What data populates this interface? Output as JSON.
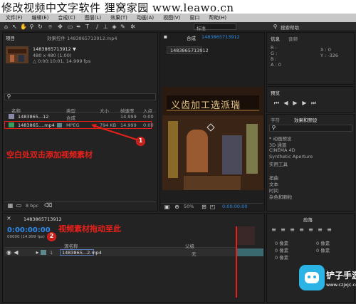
{
  "banner": {
    "title": "修改视频中文字软件 狸窝家园 www.leawo.cn"
  },
  "menu": [
    "文件(F)",
    "编辑(E)",
    "合成(C)",
    "图层(L)",
    "效果(T)",
    "动画(A)",
    "视图(V)",
    "窗口",
    "帮助(H)"
  ],
  "toolbar": {
    "mode_label": "标准",
    "search_placeholder": "搜索帮助"
  },
  "project_panel": {
    "tab_project": "项目",
    "tab_effects": "效果控件 1483865713912.mp4",
    "item_name": "1483865713912 ▼",
    "item_dims": "480 x 480 (1.00)",
    "item_duration": "△ 0:00:10:01, 14.999 fps",
    "columns": [
      "名称",
      "类型",
      "大小",
      "帧速率",
      "入点"
    ],
    "rows": [
      {
        "name": "1483865...12",
        "type": "合成",
        "size": "",
        "fps": "14.999",
        "in": "0:00"
      },
      {
        "name": "1483865....mp4",
        "type": "MPEG",
        "size": "794 KB",
        "fps": "14.999",
        "in": "0:00"
      }
    ],
    "bpc": "8 bpc"
  },
  "comp_panel": {
    "tab_label": "合成",
    "tab_name": "1483865713912",
    "sub_tab": "1483865713912",
    "video_sign": "义齿加工选派瑞",
    "zoom": "50%",
    "timecode": "0:00:00:00"
  },
  "info_panel": {
    "tab_info": "信息",
    "tab_audio": "音频",
    "labels": [
      "R :",
      "G :",
      "B :",
      "A : 0"
    ],
    "x_label": "X : 0",
    "y_label": "Y : -326"
  },
  "preview_panel": {
    "tab": "预览"
  },
  "effects_panel": {
    "tab_char": "字符",
    "tab": "效果和预设",
    "items": [
      "* 动画预设",
      "3D 通道",
      "CINEMA 4D",
      "Synthetic Aperture",
      "实用工具",
      "扭曲",
      "文本",
      "时间",
      "杂色和颗粒"
    ]
  },
  "timeline": {
    "tab_name": "1483865713912",
    "timecode": "0:00:00:00",
    "fps_line": "00000 (14.999 fps)",
    "col_source": "源名称",
    "col_parent": "父级",
    "layer_index": "1",
    "layer_name": "1483865...2.mp4",
    "parent_value": "无"
  },
  "paragraph_panel": {
    "tab": "段落",
    "values": [
      "0 像素",
      "0 像素",
      "0 像素",
      "0 像素",
      "0 像素"
    ]
  },
  "annotations": {
    "instruction1": "空白处双击添加视频素材",
    "instruction2": "视频素材拖动至此",
    "badge1": "1",
    "badge2": "2"
  },
  "watermark": {
    "title": "铲子手游网",
    "url": "www.czjxjc.com"
  },
  "colors": {
    "accent": "#2d8ceb",
    "annotation": "#e8201a",
    "panel_bg": "#232323",
    "banner_bg": "#ffffff"
  }
}
